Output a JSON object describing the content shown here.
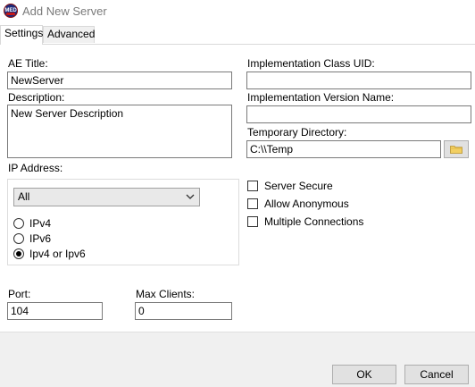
{
  "window": {
    "title": "Add New Server",
    "app_icon_text": "MED",
    "icon": "app-logo-icon"
  },
  "tabs": [
    {
      "label": "Settings",
      "active": true
    },
    {
      "label": "Advanced",
      "active": false
    }
  ],
  "left": {
    "ae_title": {
      "label": "AE Title:",
      "value": "NewServer"
    },
    "description": {
      "label": "Description:",
      "value": "New Server Description"
    },
    "ip_address": {
      "label": "IP Address:",
      "selected": "All",
      "options": [
        {
          "label": "IPv4",
          "checked": false
        },
        {
          "label": "IPv6",
          "checked": false
        },
        {
          "label": "Ipv4 or Ipv6",
          "checked": true
        }
      ]
    },
    "port": {
      "label": "Port:",
      "value": "104"
    },
    "max_clients": {
      "label": "Max Clients:",
      "value": "0"
    }
  },
  "right": {
    "impl_class_uid": {
      "label": "Implementation Class UID:",
      "value": ""
    },
    "impl_version_name": {
      "label": "Implementation Version Name:",
      "value": ""
    },
    "temp_dir": {
      "label": "Temporary Directory:",
      "value": "C:\\\\Temp",
      "icon": "folder-icon"
    },
    "checkboxes": [
      {
        "label": "Server Secure",
        "checked": false
      },
      {
        "label": "Allow Anonymous",
        "checked": false
      },
      {
        "label": "Multiple Connections",
        "checked": false
      }
    ]
  },
  "buttons": {
    "ok": "OK",
    "cancel": "Cancel"
  }
}
